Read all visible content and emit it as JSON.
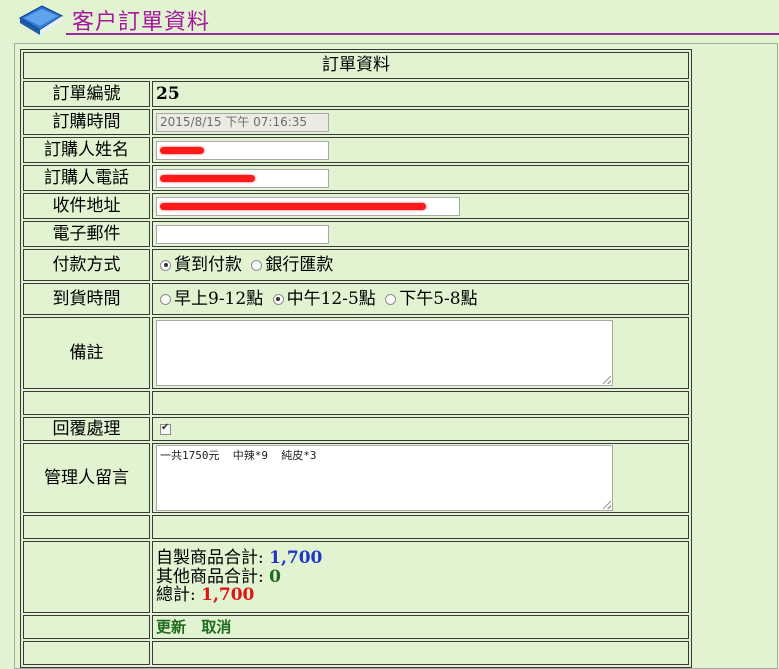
{
  "header": {
    "title": "客户訂單資料",
    "icon": "book-icon"
  },
  "form": {
    "heading": "訂單資料",
    "order_no_label": "訂單編號",
    "order_no": "25",
    "order_time_label": "訂購時間",
    "order_time": "2015/8/15 下午 07:16:35",
    "buyer_name_label": "訂購人姓名",
    "buyer_phone_label": "訂購人電話",
    "address_label": "收件地址",
    "email_label": "電子郵件",
    "email": "",
    "payment_label": "付款方式",
    "payment_options": [
      "貨到付款",
      "銀行匯款"
    ],
    "payment_selected": "貨到付款",
    "delivery_label": "到貨時間",
    "delivery_options": [
      "早上9-12點",
      "中午12-5點",
      "下午5-8點"
    ],
    "delivery_selected": "中午12-5點",
    "remarks_label": "備註",
    "remarks": "",
    "reply_label": "回覆處理",
    "reply_checked": true,
    "admin_msg_label": "管理人留言",
    "admin_msg": "一共1750元  中辣*9  純皮*3",
    "homemade_label": "自製商品合計:",
    "homemade_total": "1,700",
    "other_label": "其他商品合計:",
    "other_total": "0",
    "grand_label": "總計:",
    "grand_total": "1,700",
    "update_label": "更新",
    "cancel_label": "取消"
  },
  "colors": {
    "page_bg": "#e2f3d1",
    "title": "#a5179e",
    "blue": "#1f36c9",
    "green": "#1f6b1f",
    "red": "#e11414"
  }
}
